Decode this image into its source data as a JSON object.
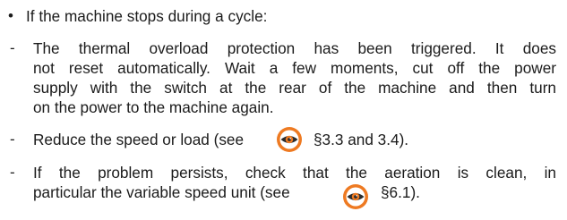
{
  "section": {
    "heading_bullet": "•",
    "heading": "If the machine stops during a cycle:",
    "items": [
      {
        "marker": "-",
        "lines": [
          "The thermal overload protection has been triggered. It does",
          "not reset automatically. Wait a few moments, cut off the power",
          "supply with the switch at the rear of the machine and then turn",
          "on the power to the machine again."
        ]
      },
      {
        "marker": "-",
        "text_before_icon": "Reduce the speed or load (see",
        "icon": "eye-icon",
        "text_after_icon": "§3.3 and 3.4)."
      },
      {
        "marker": "-",
        "line1": "If the problem persists, check that the aeration is clean, in",
        "line2_before_icon": "particular the variable speed unit (see",
        "icon": "eye-icon",
        "line2_after_icon": "§6.1)."
      }
    ]
  },
  "colors": {
    "text": "#1b1b1b",
    "icon_orange": "#ee7a22",
    "icon_dark": "#2b2b2b"
  }
}
